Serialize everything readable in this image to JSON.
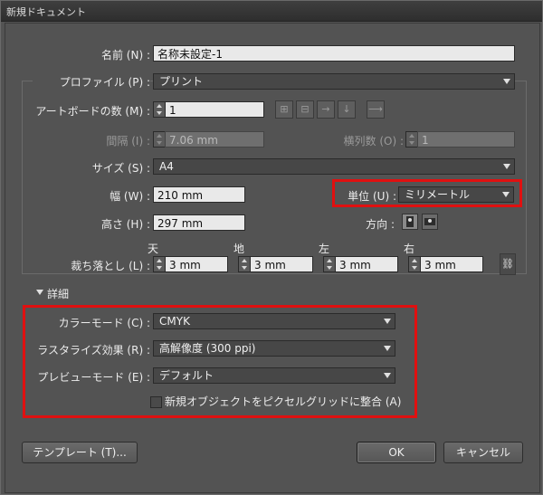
{
  "window": {
    "title": "新規ドキュメント"
  },
  "name": {
    "label": "名前 (N) :",
    "value": "名称未設定-1"
  },
  "profile": {
    "label": "プロファイル (P) :",
    "value": "プリント"
  },
  "artboards": {
    "label": "アートボードの数 (M) :",
    "value": "1",
    "layout_icons": [
      "grid-by-row-icon",
      "grid-by-column-icon",
      "arrange-by-row-icon",
      "arrange-by-column-icon",
      "right-to-left-icon"
    ]
  },
  "spacing": {
    "label": "間隔 (I) :",
    "value": "7.06 mm"
  },
  "columns": {
    "label": "横列数 (O) :",
    "value": "1"
  },
  "size": {
    "label": "サイズ (S) :",
    "value": "A4"
  },
  "width": {
    "label": "幅 (W) :",
    "value": "210 mm"
  },
  "units": {
    "label": "単位 (U) :",
    "value": "ミリメートル"
  },
  "height": {
    "label": "高さ (H) :",
    "value": "297 mm"
  },
  "orientation": {
    "label": "方向 :",
    "options": [
      "portrait",
      "landscape"
    ],
    "selected": "portrait"
  },
  "bleed": {
    "label": "裁ち落とし (L) :",
    "top": {
      "label": "天",
      "value": "3 mm"
    },
    "bottom": {
      "label": "地",
      "value": "3 mm"
    },
    "left": {
      "label": "左",
      "value": "3 mm"
    },
    "right": {
      "label": "右",
      "value": "3 mm"
    },
    "linked": true
  },
  "advanced": {
    "toggle_label": "詳細",
    "color_mode": {
      "label": "カラーモード (C) :",
      "value": "CMYK"
    },
    "raster_effects": {
      "label": "ラスタライズ効果 (R) :",
      "value": "高解像度 (300 ppi)"
    },
    "preview_mode": {
      "label": "プレビューモード (E) :",
      "value": "デフォルト"
    },
    "align_to_pixel_grid": {
      "label": "新規オブジェクトをピクセルグリッドに整合 (A)",
      "checked": false
    }
  },
  "buttons": {
    "templates": "テンプレート (T)...",
    "ok": "OK",
    "cancel": "キャンセル"
  },
  "colors": {
    "highlight": "#e01010",
    "dialog_bg": "#535353"
  }
}
